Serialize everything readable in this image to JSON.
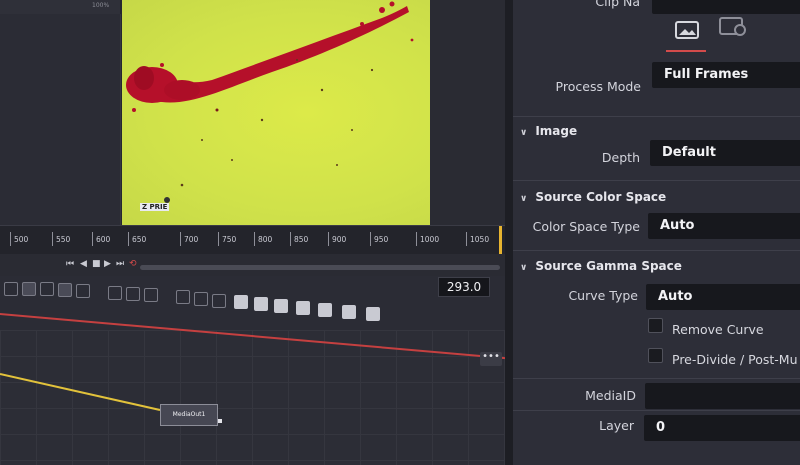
{
  "viewer": {
    "top_strip_labels": [
      "100%"
    ],
    "logo_text": "Z PRIE"
  },
  "timeline": {
    "ticks": [
      "500",
      "550",
      "600",
      "650",
      "700",
      "750",
      "800",
      "850",
      "900",
      "950",
      "1000",
      "1050"
    ],
    "frame_counter": "293.0"
  },
  "transport": {
    "buttons": [
      "⏮",
      "◀",
      "■",
      "▶",
      "⏭",
      "⟲"
    ]
  },
  "node_editor": {
    "menu_label": "•••",
    "media_out_label": "MediaOut1"
  },
  "inspector": {
    "clip_name_label": "Clip Na",
    "process_mode_label": "Process Mode",
    "process_mode_value": "Full Frames",
    "image_section": "Image",
    "depth_label": "Depth",
    "depth_value": "Default",
    "source_color_section": "Source Color Space",
    "color_space_type_label": "Color Space Type",
    "color_space_type_value": "Auto",
    "source_gamma_section": "Source Gamma Space",
    "curve_type_label": "Curve Type",
    "curve_type_value": "Auto",
    "remove_curve_label": "Remove Curve",
    "predivide_label": "Pre-Divide / Post-Mu",
    "media_id_label": "MediaID",
    "layer_label": "Layer",
    "layer_value": "0"
  },
  "colors": {
    "accent_red": "#d34b4b",
    "playhead_yellow": "#e7b430",
    "frame_green": "#d6e649",
    "splatter_red": "#b8112a"
  }
}
